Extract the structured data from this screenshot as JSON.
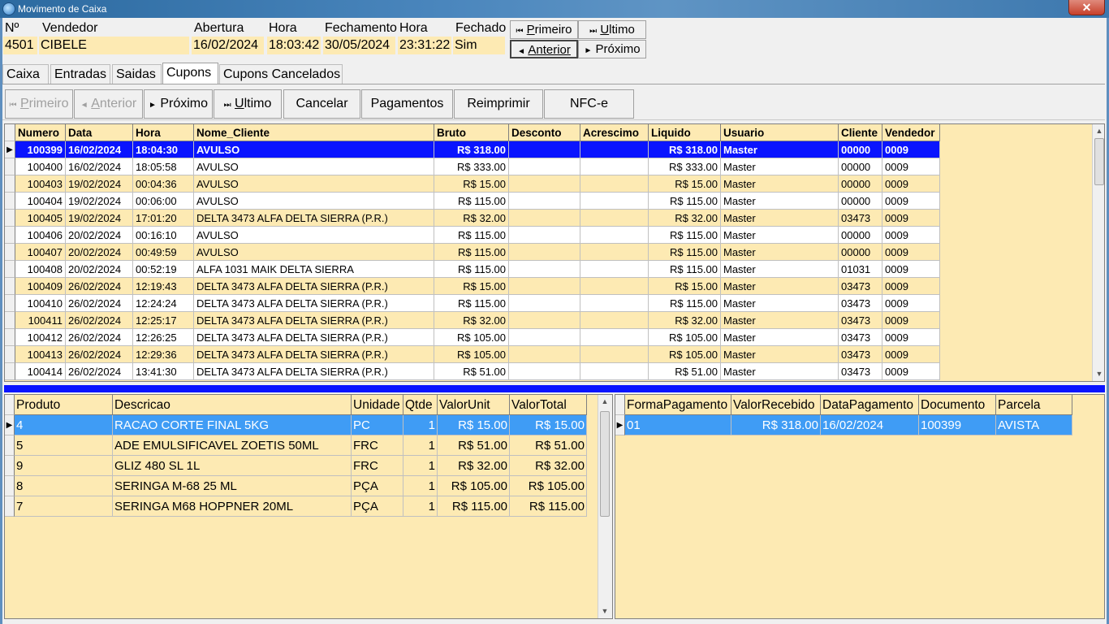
{
  "window": {
    "title": "Movimento de Caixa",
    "close_label": "✕"
  },
  "header": {
    "labels": {
      "numero": "Nº",
      "vendedor": "Vendedor",
      "abertura": "Abertura",
      "hora_abertura": "Hora",
      "fechamento": "Fechamento",
      "hora_fechamento": "Hora",
      "fechado": "Fechado"
    },
    "values": {
      "numero": "4501",
      "vendedor": "CIBELE",
      "abertura": "16/02/2024",
      "hora_abertura": "18:03:42",
      "fechamento": "30/05/2024",
      "hora_fechamento": "23:31:22",
      "fechado": "Sim"
    }
  },
  "record_nav": {
    "primeiro": {
      "icon": "⏮",
      "underline": "P",
      "rest": "rimeiro"
    },
    "ultimo": {
      "icon": "⏭",
      "underline": "U",
      "rest": "ltimo"
    },
    "anterior": {
      "icon": "◄",
      "underline": "A",
      "rest": "nterior"
    },
    "proximo": {
      "icon": "►",
      "underline": "",
      "rest": "Próximo"
    }
  },
  "tabs": [
    "Caixa",
    "Entradas",
    "Saidas",
    "Cupons",
    "Cupons Cancelados"
  ],
  "active_tab": "Cupons",
  "toolbar": {
    "primeiro": {
      "icon": "⏮",
      "underline": "P",
      "rest": "rimeiro"
    },
    "anterior": {
      "icon": "◄",
      "underline": "A",
      "rest": "nterior"
    },
    "proximo": {
      "icon": "►",
      "underline": "",
      "rest": "Próximo"
    },
    "ultimo": {
      "icon": "⏭",
      "underline": "U",
      "rest": "ltimo"
    },
    "cancelar": "Cancelar",
    "pagamentos": "Pagamentos",
    "reimprimir": "Reimprimir",
    "nfce": "NFC-e"
  },
  "cupons": {
    "columns": [
      "Numero",
      "Data",
      "Hora",
      "Nome_Cliente",
      "Bruto",
      "Desconto",
      "Acrescimo",
      "Liquido",
      "Usuario",
      "Cliente",
      "Vendedor"
    ],
    "rows": [
      [
        "100399",
        "16/02/2024",
        "18:04:30",
        "AVULSO",
        "R$ 318.00",
        "",
        "",
        "R$ 318.00",
        "Master",
        "00000",
        "0009"
      ],
      [
        "100400",
        "16/02/2024",
        "18:05:58",
        "AVULSO",
        "R$ 333.00",
        "",
        "",
        "R$ 333.00",
        "Master",
        "00000",
        "0009"
      ],
      [
        "100403",
        "19/02/2024",
        "00:04:36",
        "AVULSO",
        "R$ 15.00",
        "",
        "",
        "R$ 15.00",
        "Master",
        "00000",
        "0009"
      ],
      [
        "100404",
        "19/02/2024",
        "00:06:00",
        "AVULSO",
        "R$ 115.00",
        "",
        "",
        "R$ 115.00",
        "Master",
        "00000",
        "0009"
      ],
      [
        "100405",
        "19/02/2024",
        "17:01:20",
        "DELTA 3473 ALFA DELTA SIERRA (P.R.)",
        "R$ 32.00",
        "",
        "",
        "R$ 32.00",
        "Master",
        "03473",
        "0009"
      ],
      [
        "100406",
        "20/02/2024",
        "00:16:10",
        "AVULSO",
        "R$ 115.00",
        "",
        "",
        "R$ 115.00",
        "Master",
        "00000",
        "0009"
      ],
      [
        "100407",
        "20/02/2024",
        "00:49:59",
        "AVULSO",
        "R$ 115.00",
        "",
        "",
        "R$ 115.00",
        "Master",
        "00000",
        "0009"
      ],
      [
        "100408",
        "20/02/2024",
        "00:52:19",
        "ALFA 1031 MAIK DELTA SIERRA",
        "R$ 115.00",
        "",
        "",
        "R$ 115.00",
        "Master",
        "01031",
        "0009"
      ],
      [
        "100409",
        "26/02/2024",
        "12:19:43",
        "DELTA 3473 ALFA DELTA SIERRA (P.R.)",
        "R$ 15.00",
        "",
        "",
        "R$ 15.00",
        "Master",
        "03473",
        "0009"
      ],
      [
        "100410",
        "26/02/2024",
        "12:24:24",
        "DELTA 3473 ALFA DELTA SIERRA (P.R.)",
        "R$ 115.00",
        "",
        "",
        "R$ 115.00",
        "Master",
        "03473",
        "0009"
      ],
      [
        "100411",
        "26/02/2024",
        "12:25:17",
        "DELTA 3473 ALFA DELTA SIERRA (P.R.)",
        "R$ 32.00",
        "",
        "",
        "R$ 32.00",
        "Master",
        "03473",
        "0009"
      ],
      [
        "100412",
        "26/02/2024",
        "12:26:25",
        "DELTA 3473 ALFA DELTA SIERRA (P.R.)",
        "R$ 105.00",
        "",
        "",
        "R$ 105.00",
        "Master",
        "03473",
        "0009"
      ],
      [
        "100413",
        "26/02/2024",
        "12:29:36",
        "DELTA 3473 ALFA DELTA SIERRA (P.R.)",
        "R$ 105.00",
        "",
        "",
        "R$ 105.00",
        "Master",
        "03473",
        "0009"
      ],
      [
        "100414",
        "26/02/2024",
        "13:41:30",
        "DELTA 3473 ALFA DELTA SIERRA (P.R.)",
        "R$ 51.00",
        "",
        "",
        "R$ 51.00",
        "Master",
        "03473",
        "0009"
      ]
    ]
  },
  "produtos": {
    "columns": [
      "Produto",
      "Descricao",
      "Unidade",
      "Qtde",
      "ValorUnit",
      "ValorTotal"
    ],
    "rows": [
      [
        "4",
        "RACAO CORTE FINAL 5KG",
        "PC",
        "1",
        "R$ 15.00",
        "R$ 15.00"
      ],
      [
        "5",
        "ADE EMULSIFICAVEL ZOETIS 50ML",
        "FRC",
        "1",
        "R$ 51.00",
        "R$ 51.00"
      ],
      [
        "9",
        "GLIZ 480 SL 1L",
        "FRC",
        "1",
        "R$ 32.00",
        "R$ 32.00"
      ],
      [
        "8",
        "SERINGA M-68 25 ML",
        "PÇA",
        "1",
        "R$ 105.00",
        "R$ 105.00"
      ],
      [
        "7",
        "SERINGA M68 HOPPNER 20ML",
        "PÇA",
        "1",
        "R$ 115.00",
        "R$ 115.00"
      ]
    ]
  },
  "pagamentos": {
    "columns": [
      "FormaPagamento",
      "ValorRecebido",
      "DataPagamento",
      "Documento",
      "Parcela"
    ],
    "rows": [
      [
        "01",
        "R$ 318.00",
        "16/02/2024",
        "100399",
        "AVISTA"
      ]
    ]
  },
  "colors": {
    "grid_bg": "#fdeab3",
    "selection": "#0a14ff",
    "detail_selection": "#3f9cf5",
    "splitter": "#0a14ff"
  }
}
